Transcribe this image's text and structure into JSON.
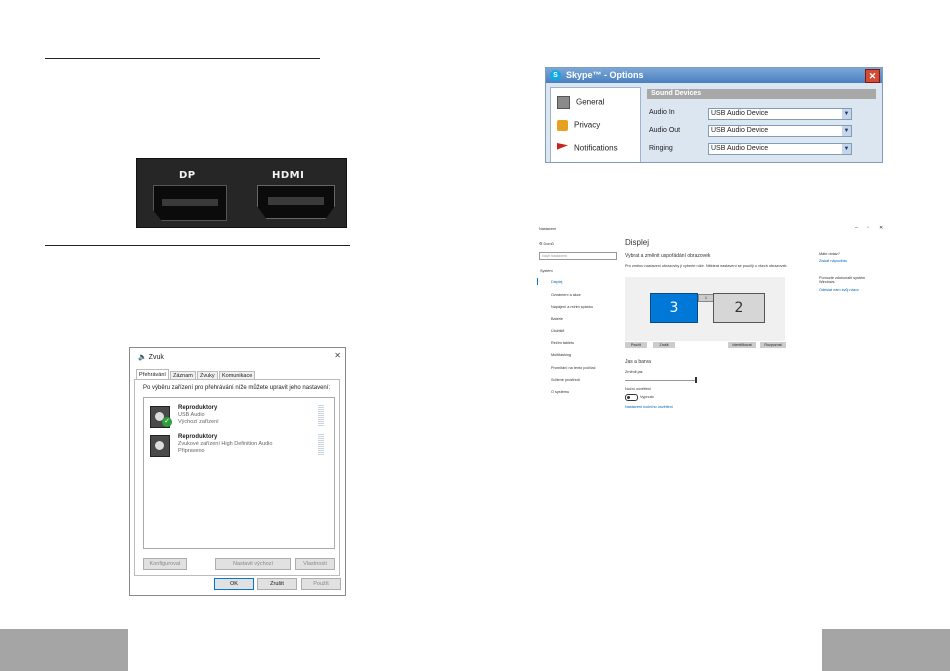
{
  "ports": {
    "dp_label": "DP",
    "hdmi_label": "HDMI"
  },
  "skype": {
    "title": "Skype™ - Options",
    "sidebar": [
      {
        "label": "General",
        "icon": "general-icon"
      },
      {
        "label": "Privacy",
        "icon": "lock-icon"
      },
      {
        "label": "Notifications",
        "icon": "flag-icon"
      }
    ],
    "section_title": "Sound Devices",
    "rows": [
      {
        "label": "Audio In",
        "value": "USB Audio Device"
      },
      {
        "label": "Audio Out",
        "value": "USB Audio Device"
      },
      {
        "label": "Ringing",
        "value": "USB Audio Device"
      }
    ]
  },
  "zvuk": {
    "title": "Zvuk",
    "tabs": [
      "Přehrávání",
      "Záznam",
      "Zvuky",
      "Komunikace"
    ],
    "description": "Po výběru zařízení pro přehrávání níže můžete upravit jeho nastavení:",
    "devices": [
      {
        "name": "Reproduktory",
        "line1": "USB Audio",
        "line2": "Výchozí zařízení"
      },
      {
        "name": "Reproduktory",
        "line1": "Zvukové zařízení High Definition Audio",
        "line2": "Připraveno"
      }
    ],
    "buttons": {
      "configure": "Konfigurovat",
      "default": "Nastavit výchozí",
      "properties": "Vlastnosti",
      "ok": "OK",
      "cancel": "Zrušit",
      "apply": "Použít"
    }
  },
  "nastaveni": {
    "window_title": "Nastavení",
    "home": "Domů",
    "search_placeholder": "Najít nastavení",
    "category": "Systém",
    "nav": [
      "Displej",
      "Oznámení a akce",
      "Napájení a režim spánku",
      "Baterie",
      "Úložiště",
      "Režim tabletu",
      "Multitasking",
      "Promítání na tento počítač",
      "Sdílené prostředí",
      "O systému"
    ],
    "page_title": "Displej",
    "subtitle": "Vybrat a změnit uspořádání obrazovek",
    "hint": "Pro změnu nastavení obrazovky ji vyberte níže. Některá nastavení se použijí u všech obrazovek.",
    "monitor1": "3",
    "monitor2": "2",
    "btn_identify": "Použít",
    "btn_detect": "Zrušit",
    "btn_identify2": "Identifikovat",
    "btn_detect2": "Rozpoznat",
    "color_section": "Jas a barva",
    "brightness": "Změnit jas",
    "night_light": "Noční osvětlení",
    "night_state": "Vypnuto",
    "night_link": "Nastavení nočního osvětlení",
    "side_q1": "Máte dotaz?",
    "side_link1": "Získat nápovědu",
    "side_q2": "Pomozte zdokonalit systém Windows.",
    "side_link2": "Odeslat nám svůj názor"
  }
}
